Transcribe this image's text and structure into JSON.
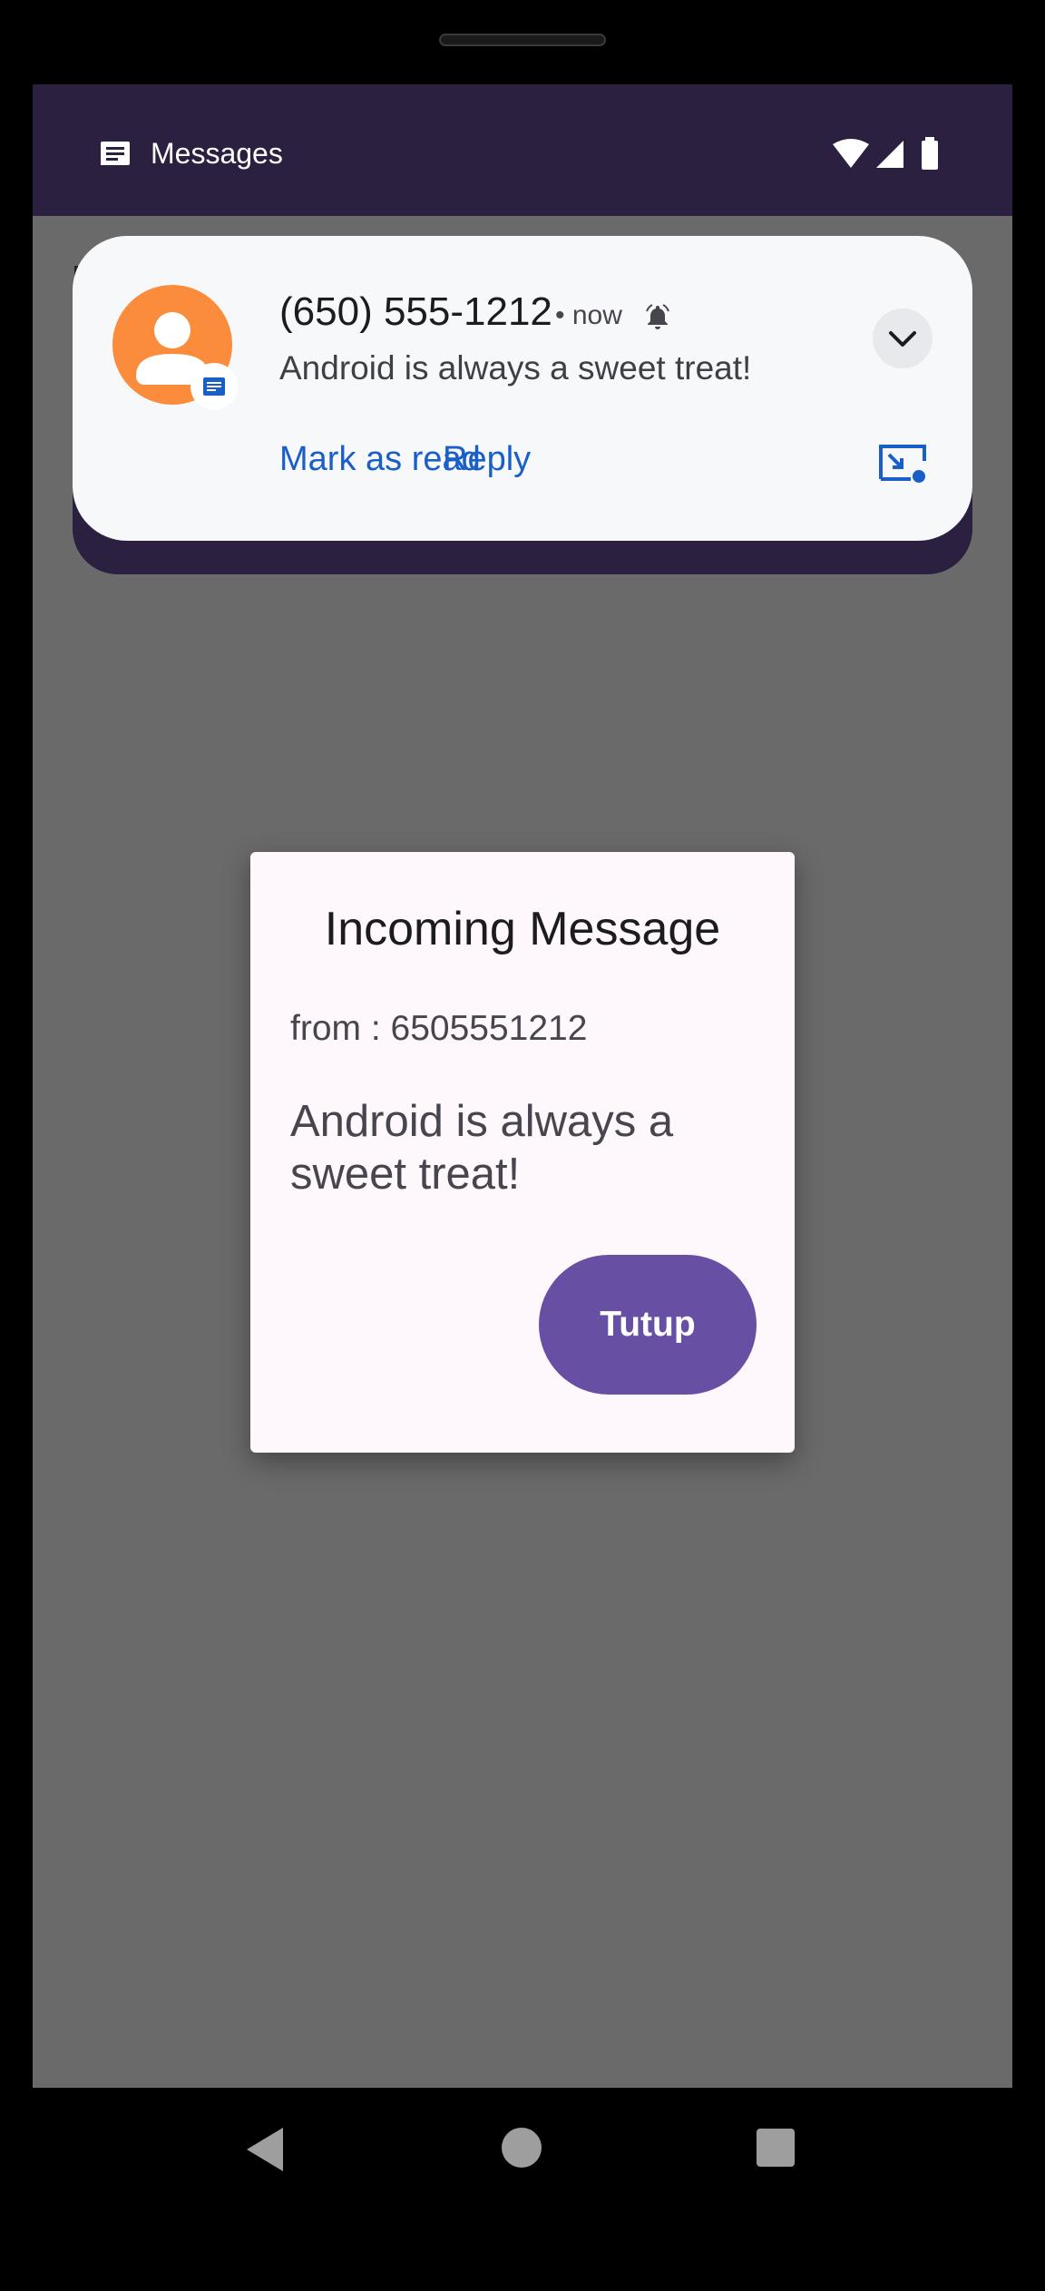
{
  "status_bar": {
    "app_name": "Messages"
  },
  "notification": {
    "title": "(650) 555-1212",
    "meta": "• now",
    "body": "Android is always a sweet treat!",
    "actions": [
      {
        "label": "Mark as read"
      },
      {
        "label": "Reply"
      }
    ],
    "avatar_color": "#fb8c3c",
    "action_color": "#1a5fc8"
  },
  "dialog": {
    "title": "Incoming Message",
    "from": "from : 6505551212",
    "body": "Android is always a sweet treat!",
    "button_label": "Tutup",
    "button_color": "#6750a4"
  },
  "nav": {
    "back_icon": "back-triangle-icon",
    "home_icon": "home-circle-icon",
    "recents_icon": "recents-square-icon"
  }
}
